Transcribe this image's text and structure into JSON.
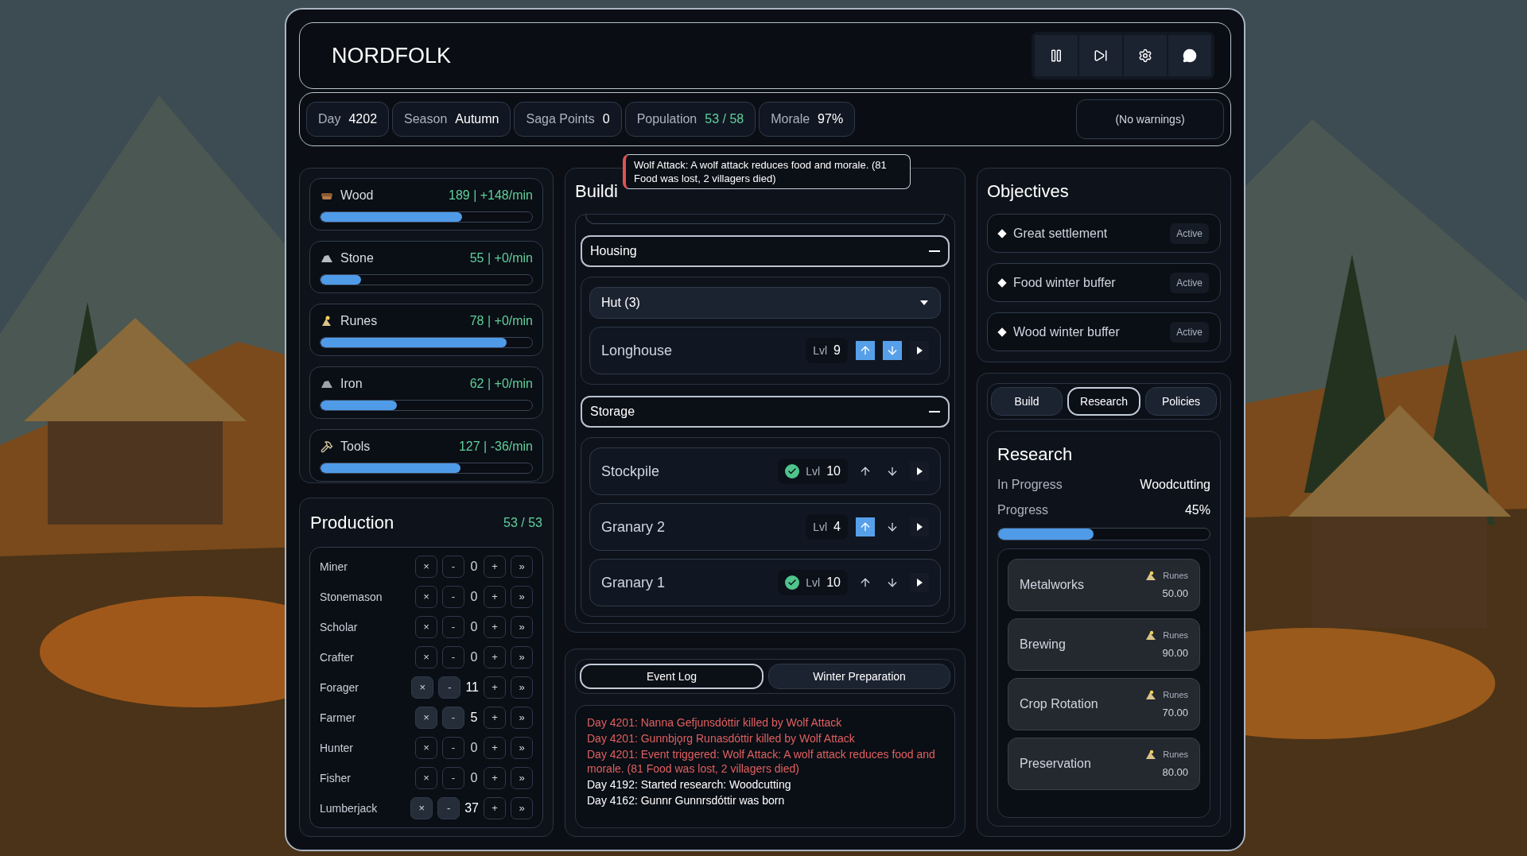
{
  "header": {
    "title": "NORDFOLK"
  },
  "stats": [
    {
      "label": "Day",
      "value": "4202",
      "kind": "plain"
    },
    {
      "label": "Season",
      "value": "Autumn",
      "kind": "plain"
    },
    {
      "label": "Saga Points",
      "value": "0",
      "kind": "plain"
    },
    {
      "label": "Population",
      "value": "53 / 58",
      "kind": "good"
    },
    {
      "label": "Morale",
      "value": "97%",
      "kind": "plain"
    }
  ],
  "warnings": "(No warnings)",
  "resources": [
    {
      "name": "Wood",
      "reading": "189 | +148/min",
      "level": 0.67
    },
    {
      "name": "Stone",
      "reading": "55 | +0/min",
      "level": 0.19
    },
    {
      "name": "Runes",
      "reading": "78 | +0/min",
      "level": 0.88
    },
    {
      "name": "Iron",
      "reading": "62 | +0/min",
      "level": 0.36
    },
    {
      "name": "Tools",
      "reading": "127 | -36/min",
      "level": 0.66
    }
  ],
  "production": {
    "title": "Production",
    "count": "53 / 53",
    "rows": [
      {
        "name": "Miner",
        "count": "0",
        "enabled": false,
        "clear": "×",
        "minus": "-",
        "plus": "+",
        "max": "»"
      },
      {
        "name": "Stonemason",
        "count": "0",
        "enabled": false,
        "clear": "×",
        "minus": "-",
        "plus": "+",
        "max": "»"
      },
      {
        "name": "Scholar",
        "count": "0",
        "enabled": false,
        "clear": "×",
        "minus": "-",
        "plus": "+",
        "max": "»"
      },
      {
        "name": "Crafter",
        "count": "0",
        "enabled": false,
        "clear": "×",
        "minus": "-",
        "plus": "+",
        "max": "»"
      },
      {
        "name": "Forager",
        "count": "11",
        "enabled": true,
        "clear": "×",
        "minus": "-",
        "plus": "+",
        "max": "»"
      },
      {
        "name": "Farmer",
        "count": "5",
        "enabled": true,
        "clear": "×",
        "minus": "-",
        "plus": "+",
        "max": "»"
      },
      {
        "name": "Hunter",
        "count": "0",
        "enabled": false,
        "clear": "×",
        "minus": "-",
        "plus": "+",
        "max": "»"
      },
      {
        "name": "Fisher",
        "count": "0",
        "enabled": false,
        "clear": "×",
        "minus": "-",
        "plus": "+",
        "max": "»"
      },
      {
        "name": "Lumberjack",
        "count": "37",
        "enabled": true,
        "clear": "×",
        "minus": "-",
        "plus": "+",
        "max": "»"
      }
    ]
  },
  "buildings": {
    "title": "Buildi",
    "tooltip": "Wolf Attack: A wolf attack reduces food and morale. (81 Food was lost, 2 villagers died)",
    "groups": [
      {
        "name": "Housing",
        "expanded": true,
        "items": [
          {
            "kind": "dropdown",
            "name": "Hut (3)"
          },
          {
            "kind": "building",
            "name": "Longhouse",
            "lvl_label": "Lvl",
            "lvl": "9",
            "maxed": false,
            "can_upgrade": true,
            "can_downgrade": true
          }
        ]
      },
      {
        "name": "Storage",
        "expanded": true,
        "items": [
          {
            "kind": "building",
            "name": "Stockpile",
            "lvl_label": "Lvl",
            "lvl": "10",
            "maxed": true,
            "can_upgrade": false,
            "can_downgrade": false
          },
          {
            "kind": "building",
            "name": "Granary 2",
            "lvl_label": "Lvl",
            "lvl": "4",
            "maxed": false,
            "can_upgrade": true,
            "can_downgrade": false
          },
          {
            "kind": "building",
            "name": "Granary 1",
            "lvl_label": "Lvl",
            "lvl": "10",
            "maxed": true,
            "can_upgrade": false,
            "can_downgrade": false
          }
        ]
      }
    ]
  },
  "log": {
    "tabs": [
      {
        "label": "Event Log",
        "selected": true
      },
      {
        "label": "Winter Preparation",
        "selected": false
      }
    ],
    "entries": [
      {
        "text": "Day 4201: Nanna Gefjunsdóttir killed by Wolf Attack",
        "kind": "alert"
      },
      {
        "text": "Day 4201: Gunnbjǫrg Runasdóttir killed by Wolf Attack",
        "kind": "alert"
      },
      {
        "text": "Day 4201: Event triggered: Wolf Attack: A wolf attack reduces food and morale. (81 Food was lost, 2 villagers died)",
        "kind": "alert"
      },
      {
        "text": "Day 4192: Started research: Woodcutting",
        "kind": "info"
      },
      {
        "text": "Day 4162: Gunnr Gunnrsdóttir was born",
        "kind": "info"
      }
    ]
  },
  "objectives": {
    "title": "Objectives",
    "items": [
      {
        "name": "Great settlement",
        "status": "Active"
      },
      {
        "name": "Food winter buffer",
        "status": "Active"
      },
      {
        "name": "Wood winter buffer",
        "status": "Active"
      }
    ]
  },
  "actions": {
    "tabs": [
      {
        "label": "Build",
        "selected": false
      },
      {
        "label": "Research",
        "selected": true
      },
      {
        "label": "Policies",
        "selected": false
      }
    ]
  },
  "research": {
    "title": "Research",
    "in_progress_label": "In Progress",
    "in_progress": "Woodcutting",
    "progress_label": "Progress",
    "progress": "45%",
    "level": 0.45,
    "items": [
      {
        "name": "Metalworks",
        "currency": "Runes",
        "cost": "50.00"
      },
      {
        "name": "Brewing",
        "currency": "Runes",
        "cost": "90.00"
      },
      {
        "name": "Crop Rotation",
        "currency": "Runes",
        "cost": "70.00"
      },
      {
        "name": "Preservation",
        "currency": "Runes",
        "cost": "80.00"
      }
    ]
  }
}
